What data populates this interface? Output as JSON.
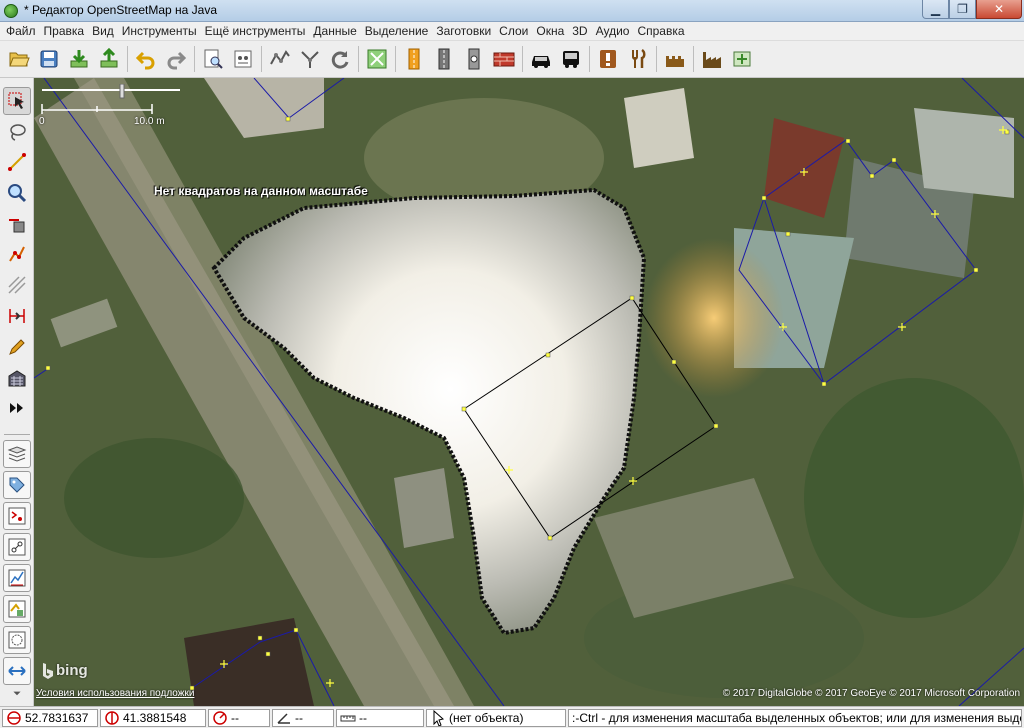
{
  "window": {
    "title": "* Редактор OpenStreetMap на Java",
    "min": "▁",
    "max": "❐",
    "close": "✕"
  },
  "menu": [
    "Файл",
    "Правка",
    "Вид",
    "Инструменты",
    "Ещё инструменты",
    "Данные",
    "Выделение",
    "Заготовки",
    "Слои",
    "Окна",
    "3D",
    "Аудио",
    "Справка"
  ],
  "map": {
    "scale_start": "0",
    "scale_end": "10.0 m",
    "no_tiles_message": "Нет квадратов на данном масштабе",
    "imagery_provider": "bing",
    "terms_link": "Условия использования подложки",
    "attribution": "© 2017 DigitalGlobe © 2017 GeoEye © 2017 Microsoft Corporation"
  },
  "status": {
    "lat": "52.7831637",
    "lon": "41.3881548",
    "heading": "--",
    "angle": "--",
    "distance": "--",
    "object": "(нет объекта)",
    "help": ":-Ctrl - для изменения масштаба выделенных объектов; или для изменения выделения"
  },
  "colors": {
    "way": "#1a1aa8",
    "node": "#ffff40",
    "selected_way": "#000000"
  }
}
